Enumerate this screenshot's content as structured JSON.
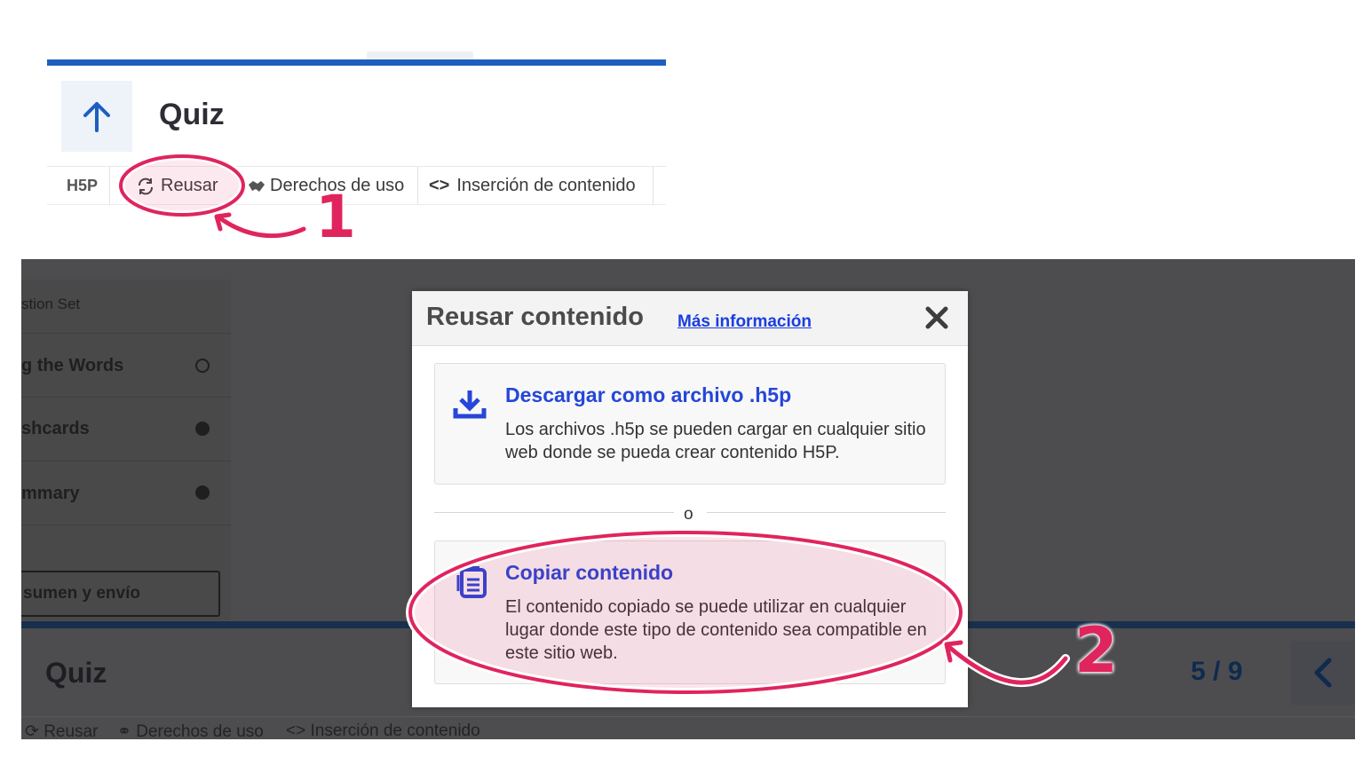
{
  "top": {
    "title": "Quiz",
    "h5p_logo": "H5P",
    "actions": {
      "reuse": "Reusar",
      "rights": "Derechos de uso",
      "embed": "Inserción de contenido"
    }
  },
  "background": {
    "sidebar": {
      "items": [
        {
          "label": "stion Set",
          "status": "none"
        },
        {
          "label": "g the Words",
          "status": "empty"
        },
        {
          "label": "shcards",
          "status": "filled"
        },
        {
          "label": "mmary",
          "status": "filled"
        }
      ],
      "button": "sumen y envío"
    },
    "footer": {
      "title": "Quiz",
      "counter": "5 / 9",
      "actions": {
        "reuse": "Reusar",
        "rights": "Derechos de uso",
        "embed": "Inserción de contenido"
      }
    }
  },
  "modal": {
    "title": "Reusar contenido",
    "more_info": "Más información",
    "option_download": {
      "title": "Descargar como archivo .h5p",
      "description": "Los archivos .h5p se pueden cargar en cualquier sitio web donde se pueda crear contenido H5P."
    },
    "or": "o",
    "option_copy": {
      "title": "Copiar contenido",
      "description": "El contenido copiado se puede utilizar en cualquier lugar donde este tipo de contenido sea compatible en este sitio web."
    }
  },
  "annotations": {
    "step1": "1",
    "step2": "2"
  },
  "icons": [
    "arrow-up-icon",
    "refresh-icon",
    "handshake-icon",
    "code-icon",
    "download-icon",
    "clipboard-icon",
    "close-icon",
    "chevron-left-icon"
  ],
  "colors": {
    "primary_blue": "#1d5fbf",
    "link_blue": "#2546d8",
    "highlight_pink": "#e0245e",
    "dark_overlay": "#4d4d4f"
  }
}
